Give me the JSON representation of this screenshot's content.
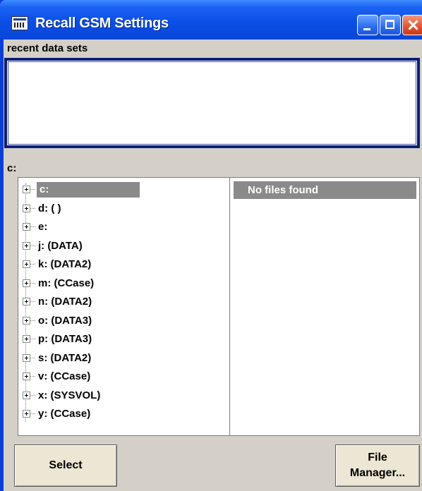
{
  "window": {
    "title": "Recall GSM Settings"
  },
  "recent": {
    "label": "recent data sets"
  },
  "browser": {
    "path_label": "c:",
    "drives": [
      {
        "label": "c:",
        "selected": true
      },
      {
        "label": "d: ( )"
      },
      {
        "label": "e:"
      },
      {
        "label": "j: (DATA)"
      },
      {
        "label": "k: (DATA2)"
      },
      {
        "label": "m: (CCase)"
      },
      {
        "label": "n: (DATA2)"
      },
      {
        "label": "o: (DATA3)"
      },
      {
        "label": "p: (DATA3)"
      },
      {
        "label": "s: (DATA2)"
      },
      {
        "label": "v: (CCase)"
      },
      {
        "label": "x: (SYSVOL)"
      },
      {
        "label": "y: (CCase)"
      }
    ],
    "files_message": "No files found"
  },
  "buttons": {
    "select": "Select",
    "file_manager_line1": "File",
    "file_manager_line2": "Manager..."
  },
  "colors": {
    "titlebar": "#0b4fe6",
    "frame": "#0a3fd6",
    "dialog_bg": "#d4d0c8",
    "selection": "#8a8a8a",
    "recent_border": "#0c1d78"
  },
  "icons": {
    "app": "window-app-icon",
    "minimize": "minimize-icon",
    "maximize": "maximize-icon",
    "close": "close-icon",
    "expand": "plus-expander-icon"
  }
}
